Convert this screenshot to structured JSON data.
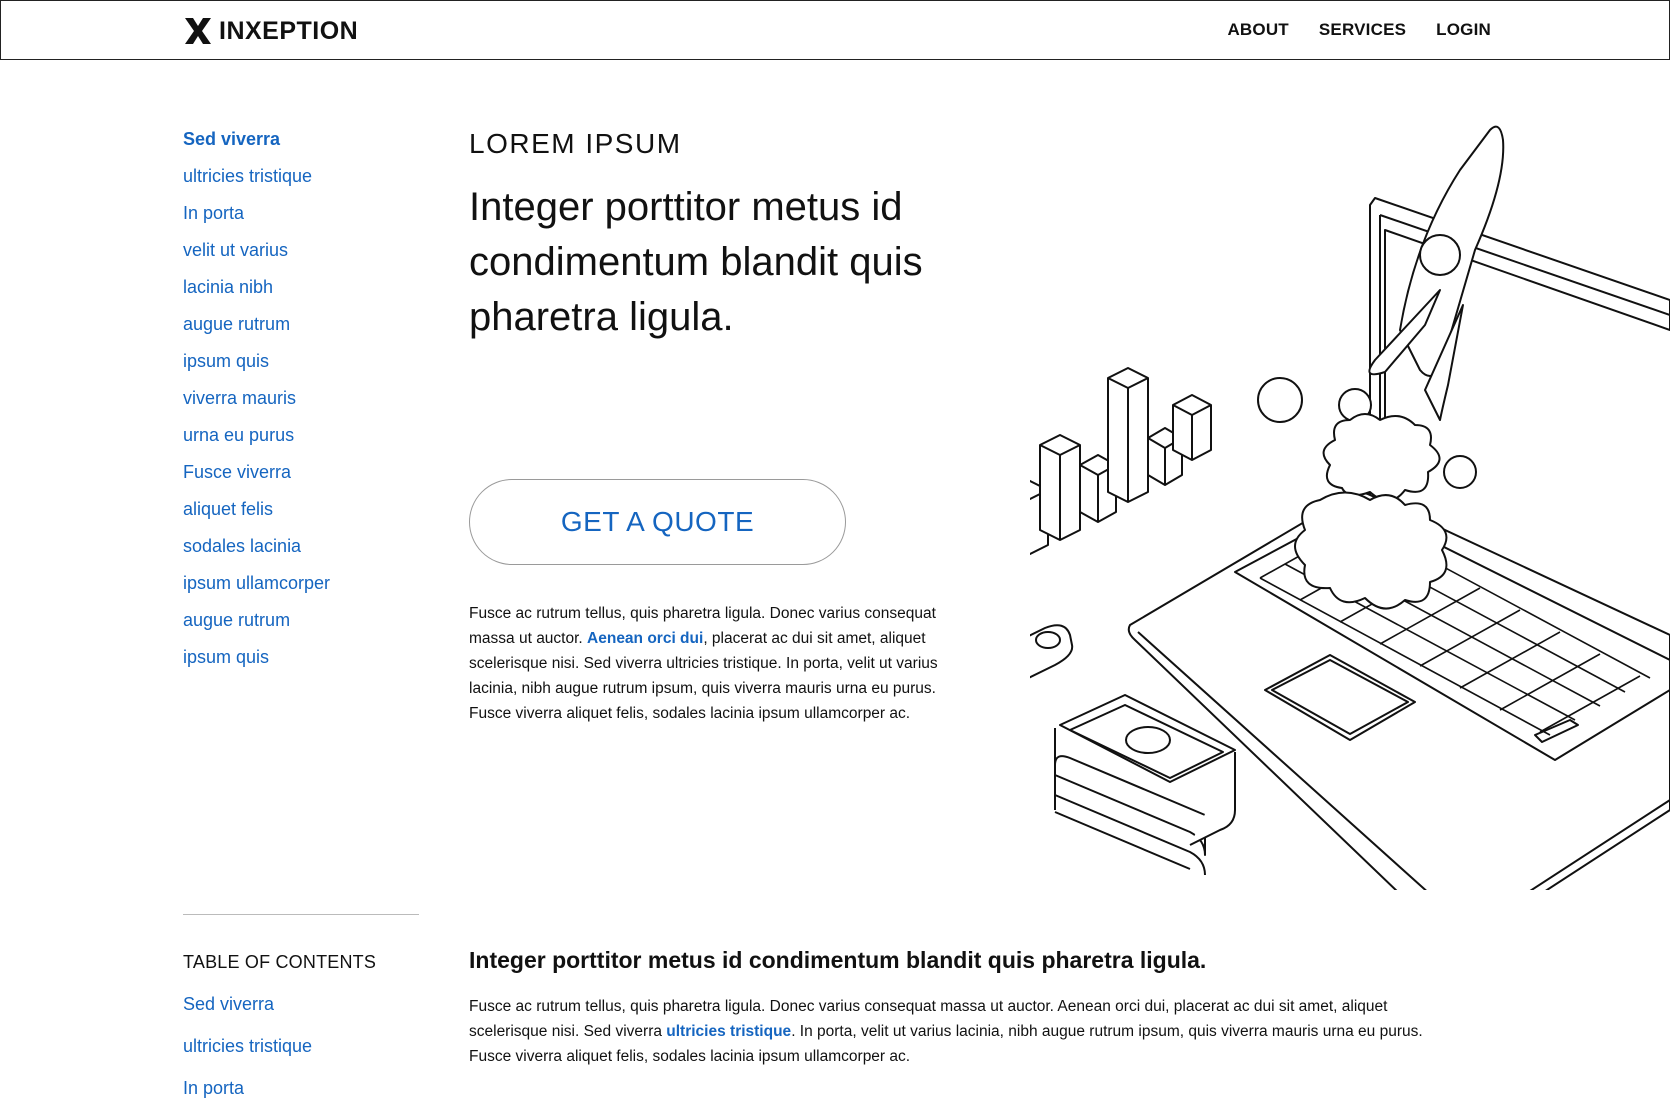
{
  "header": {
    "brand": "INXEPTION",
    "nav": [
      "ABOUT",
      "SERVICES",
      "LOGIN"
    ]
  },
  "sidebar": {
    "items": [
      "Sed viverra",
      "ultricies tristique",
      "In porta",
      "velit ut varius",
      "lacinia nibh",
      "augue rutrum",
      "ipsum quis",
      "viverra mauris",
      "urna eu purus",
      "Fusce viverra",
      "aliquet felis",
      "sodales lacinia",
      "ipsum ullamcorper",
      "augue rutrum",
      "ipsum quis"
    ]
  },
  "hero": {
    "eyebrow": "LOREM IPSUM",
    "headline": "Integer porttitor metus id condimentum blandit quis pharetra ligula.",
    "cta": "GET A QUOTE",
    "body_before": "Fusce ac rutrum tellus, quis pharetra ligula. Donec varius consequat massa ut auctor. ",
    "body_link": "Aenean orci dui",
    "body_after": ", placerat ac dui sit amet, aliquet scelerisque nisi. Sed viverra ultricies tristique. In porta, velit ut varius lacinia, nibh augue rutrum ipsum, quis viverra mauris urna eu purus. Fusce viverra aliquet felis, sodales lacinia ipsum ullamcorper ac."
  },
  "toc": {
    "title": "TABLE OF CONTENTS",
    "items": [
      "Sed viverra",
      "ultricies tristique",
      "In porta"
    ]
  },
  "section": {
    "title": "Integer porttitor metus id condimentum blandit quis pharetra ligula.",
    "body_before": "Fusce ac rutrum tellus, quis pharetra ligula. Donec varius consequat massa ut auctor. Aenean orci dui, placerat ac dui sit amet, aliquet scelerisque nisi. Sed viverra ",
    "body_link": "ultricies tristique",
    "body_after": ". In porta, velit ut varius lacinia, nibh augue rutrum ipsum, quis viverra mauris urna eu purus. Fusce viverra aliquet felis, sodales lacinia ipsum ullamcorper ac."
  },
  "colors": {
    "link": "#1565c0",
    "text": "#111111",
    "border": "#222222"
  },
  "illustration": {
    "icons": [
      "laptop-icon",
      "rocket-icon",
      "bar-chart-icon",
      "cloud-icon",
      "money-stack-icon",
      "toggle-switch-icon"
    ]
  }
}
